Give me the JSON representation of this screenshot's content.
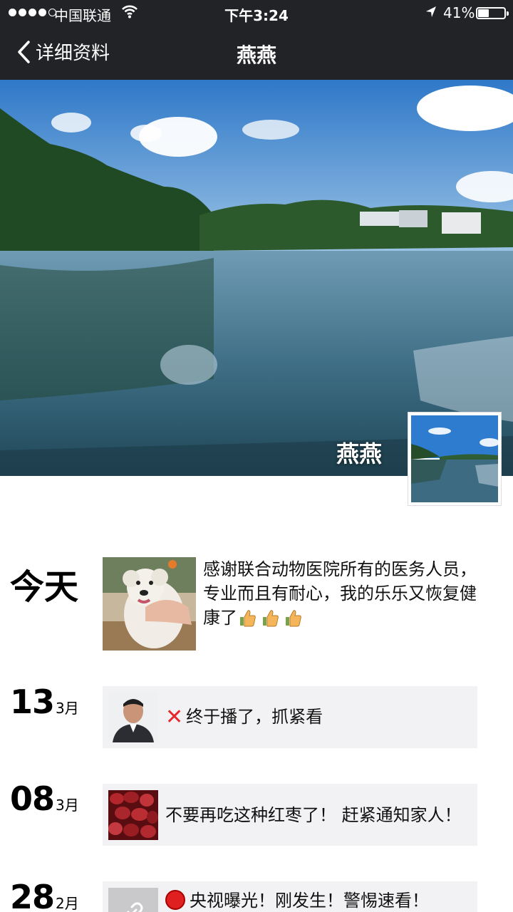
{
  "status_bar": {
    "carrier": "中国联通",
    "time": "下午3:24",
    "battery": "41%",
    "battery_level": 0.41
  },
  "nav": {
    "back_label": "详细资料",
    "title": "燕燕"
  },
  "profile": {
    "cover_name": "燕燕"
  },
  "timeline": [
    {
      "label": "今天",
      "text": "感谢联合动物医院所有的医务人员，专业而且有耐心，我的乐乐又恢复健康了",
      "emoji": [
        "thumbs-up",
        "thumbs-up",
        "thumbs-up"
      ]
    },
    {
      "day": "13",
      "month": "3月",
      "text": "终于播了，抓紧看",
      "icon": "red-x-icon"
    },
    {
      "day": "08",
      "month": "3月",
      "text": "不要再吃这种红枣了！ 赶紧通知家人！"
    },
    {
      "day": "28",
      "month": "2月",
      "text": "央视曝光！刚发生！警惕速看！",
      "icon": "red-circle-icon"
    }
  ]
}
